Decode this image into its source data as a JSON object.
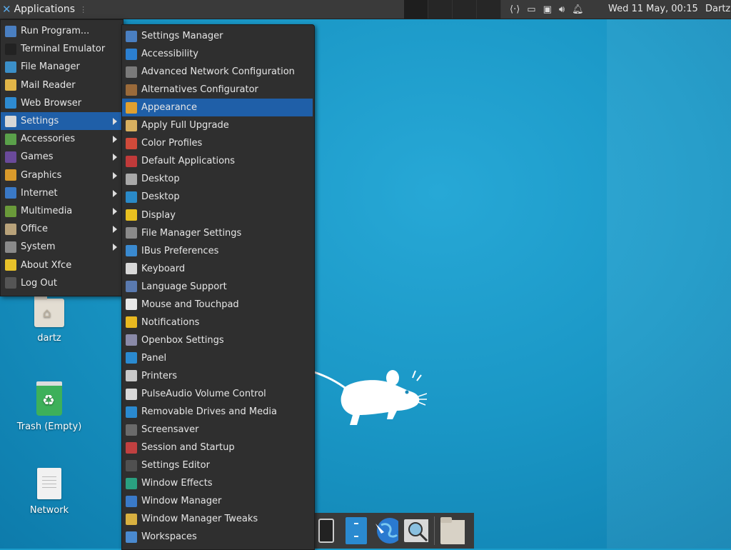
{
  "panel": {
    "applications_label": "Applications",
    "clock": "Wed 11 May, 00:15",
    "username": "Dartz",
    "tray_icons": [
      "network-arrows-icon",
      "display-icon",
      "network-icon",
      "volume-icon",
      "bell-icon"
    ]
  },
  "desktop_icons": [
    {
      "label": "dartz",
      "icon": "home-folder-icon"
    },
    {
      "label": "Trash (Empty)",
      "icon": "trash-icon"
    },
    {
      "label": "Network",
      "icon": "document-icon"
    }
  ],
  "main_menu": {
    "items": [
      {
        "label": "Run Program...",
        "icon": "run-icon",
        "color": "#4a7fc1",
        "submenu": false
      },
      {
        "label": "Terminal Emulator",
        "icon": "terminal-icon",
        "color": "#222222",
        "submenu": false
      },
      {
        "label": "File Manager",
        "icon": "file-manager-icon",
        "color": "#3b8fc8",
        "submenu": false
      },
      {
        "label": "Mail Reader",
        "icon": "mail-icon",
        "color": "#e1b548",
        "submenu": false
      },
      {
        "label": "Web Browser",
        "icon": "globe-icon",
        "color": "#2e8bd1",
        "submenu": false
      },
      {
        "label": "Settings",
        "icon": "settings-icon",
        "color": "#d7d7d7",
        "submenu": true,
        "selected": true
      },
      {
        "label": "Accessories",
        "icon": "accessories-icon",
        "color": "#5aa04a",
        "submenu": true
      },
      {
        "label": "Games",
        "icon": "games-icon",
        "color": "#6a4a9a",
        "submenu": true
      },
      {
        "label": "Graphics",
        "icon": "graphics-icon",
        "color": "#d99a2b",
        "submenu": true
      },
      {
        "label": "Internet",
        "icon": "internet-icon",
        "color": "#3a79c6",
        "submenu": true
      },
      {
        "label": "Multimedia",
        "icon": "multimedia-icon",
        "color": "#6a9a3a",
        "submenu": true
      },
      {
        "label": "Office",
        "icon": "office-icon",
        "color": "#b8a27a",
        "submenu": true
      },
      {
        "label": "System",
        "icon": "gear-icon",
        "color": "#8a8a8a",
        "submenu": true
      },
      {
        "label": "About Xfce",
        "icon": "star-icon",
        "color": "#e8c22a",
        "submenu": false
      },
      {
        "label": "Log Out",
        "icon": "logout-icon",
        "color": "#555555",
        "submenu": false
      }
    ]
  },
  "settings_menu": {
    "items": [
      {
        "label": "Settings Manager",
        "icon": "settings-manager-icon",
        "color": "#4a7fc1"
      },
      {
        "label": "Accessibility",
        "icon": "accessibility-icon",
        "color": "#2b7fd0"
      },
      {
        "label": "Advanced Network Configuration",
        "icon": "network-config-icon",
        "color": "#7a7a7a"
      },
      {
        "label": "Alternatives Configurator",
        "icon": "alternatives-icon",
        "color": "#9a6a3a"
      },
      {
        "label": "Appearance",
        "icon": "appearance-icon",
        "color": "#e0a030",
        "selected": true
      },
      {
        "label": "Apply Full Upgrade",
        "icon": "upgrade-icon",
        "color": "#d8b060"
      },
      {
        "label": "Color Profiles",
        "icon": "color-profiles-icon",
        "color": "#d04a3a"
      },
      {
        "label": "Default Applications",
        "icon": "default-apps-icon",
        "color": "#c03a3a"
      },
      {
        "label": "Desktop",
        "icon": "desktop-icon",
        "color": "#a8a8a8"
      },
      {
        "label": "Desktop",
        "icon": "desktop-blue-icon",
        "color": "#2a8ac8"
      },
      {
        "label": "Display",
        "icon": "display-icon",
        "color": "#e8c020"
      },
      {
        "label": "File Manager Settings",
        "icon": "file-manager-settings-icon",
        "color": "#8a8a8a"
      },
      {
        "label": "IBus Preferences",
        "icon": "gear-icon",
        "color": "#3a8ad0"
      },
      {
        "label": "Keyboard",
        "icon": "keyboard-icon",
        "color": "#d8d8d8"
      },
      {
        "label": "Language Support",
        "icon": "language-icon",
        "color": "#5a7ab0"
      },
      {
        "label": "Mouse and Touchpad",
        "icon": "mouse-icon",
        "color": "#e8e8e8"
      },
      {
        "label": "Notifications",
        "icon": "bell-icon",
        "color": "#e8b820"
      },
      {
        "label": "Openbox Settings",
        "icon": "openbox-icon",
        "color": "#8a8aa8"
      },
      {
        "label": "Panel",
        "icon": "panel-icon",
        "color": "#2a8ad0"
      },
      {
        "label": "Printers",
        "icon": "printer-icon",
        "color": "#c8c8c8"
      },
      {
        "label": "PulseAudio Volume Control",
        "icon": "speaker-icon",
        "color": "#d8d8d8"
      },
      {
        "label": "Removable Drives and Media",
        "icon": "drive-icon",
        "color": "#2a8ad0"
      },
      {
        "label": "Screensaver",
        "icon": "screensaver-icon",
        "color": "#6a6a6a"
      },
      {
        "label": "Session and Startup",
        "icon": "session-icon",
        "color": "#c04040"
      },
      {
        "label": "Settings Editor",
        "icon": "settings-editor-icon",
        "color": "#505050"
      },
      {
        "label": "Window Effects",
        "icon": "window-effects-icon",
        "color": "#2aa080"
      },
      {
        "label": "Window Manager",
        "icon": "window-manager-icon",
        "color": "#3a7ac8"
      },
      {
        "label": "Window Manager Tweaks",
        "icon": "wm-tweaks-icon",
        "color": "#d8b040"
      },
      {
        "label": "Workspaces",
        "icon": "workspaces-icon",
        "color": "#4a8ad0"
      }
    ]
  },
  "dock": {
    "items": [
      "terminal-icon",
      "file-cabinet-icon",
      "web-browser-icon",
      "search-icon",
      "folder-icon"
    ]
  },
  "colors": {
    "accent": "#1f5fa8",
    "desktop": "#1a9bc9",
    "menu_bg": "#2f2f2f",
    "panel_bg": "#3a3a3a"
  }
}
